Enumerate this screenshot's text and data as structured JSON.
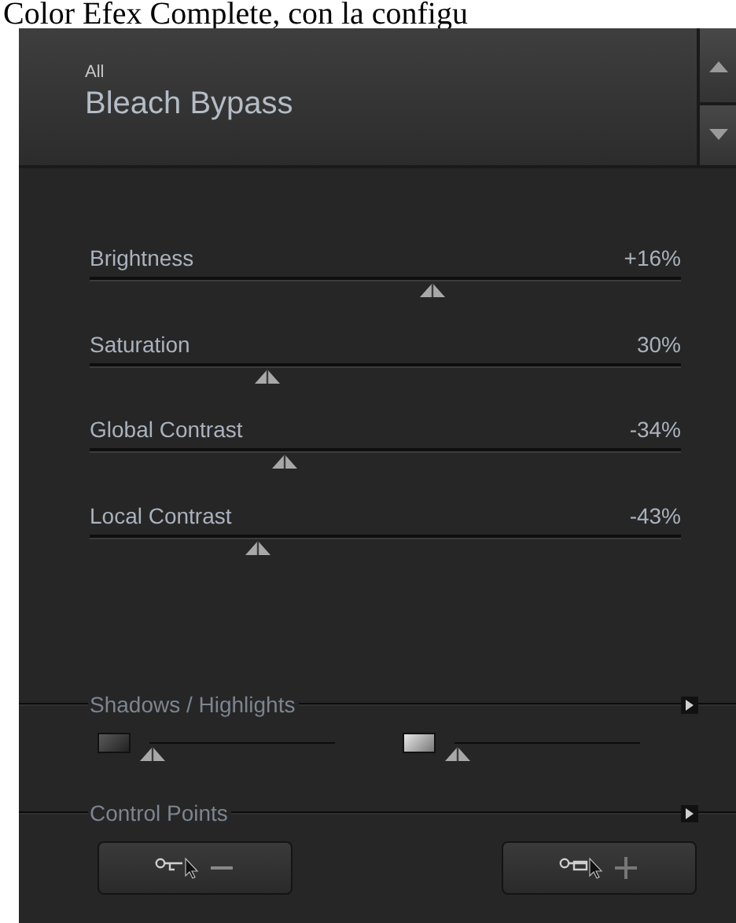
{
  "caption": "Color Efex Complete, con la configu",
  "preset": {
    "category": "All",
    "name": "Bleach Bypass"
  },
  "sliders": [
    {
      "label": "Brightness",
      "value": "+16%",
      "level": 0.58
    },
    {
      "label": "Saturation",
      "value": "30%",
      "level": 0.3
    },
    {
      "label": "Global Contrast",
      "value": "-34%",
      "level": 0.33
    },
    {
      "label": "Local Contrast",
      "value": "-43%",
      "level": 0.285
    }
  ],
  "shadows_highlights": {
    "title": "Shadows / Highlights",
    "sliders": [
      {
        "kind": "shadows",
        "level": 0
      },
      {
        "kind": "highlights",
        "level": 0
      }
    ]
  },
  "control_points": {
    "title": "Control Points",
    "buttons": [
      {
        "kind": "remove"
      },
      {
        "kind": "add"
      }
    ]
  }
}
